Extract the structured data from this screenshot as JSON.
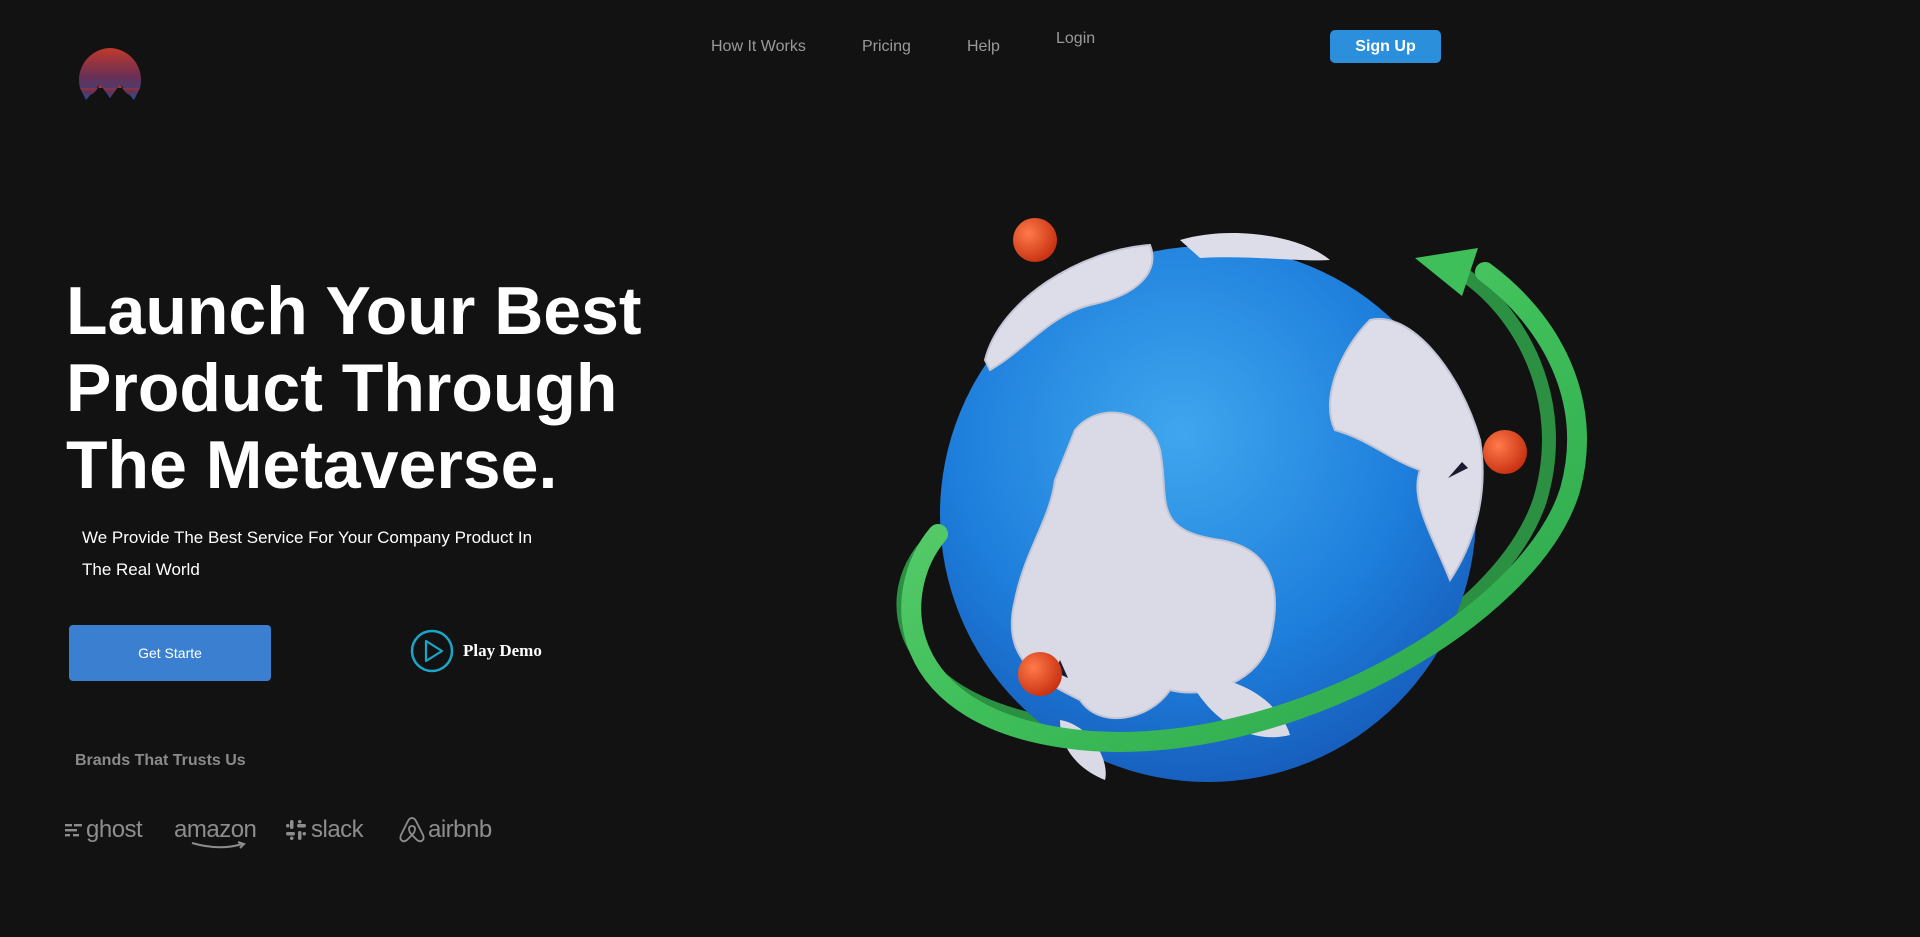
{
  "nav": {
    "links": [
      "How It Works",
      "Pricing",
      "Help",
      "Login"
    ],
    "signup_label": "Sign Up"
  },
  "hero": {
    "title_lines": [
      "Launch Your Best",
      "Product Through",
      "The Metaverse."
    ],
    "subtitle_lines": [
      "We Provide The Best Service For Your Company Product In",
      "The Real World"
    ],
    "cta_label": "Get Starte",
    "demo_label": "Play Demo"
  },
  "brands": {
    "title": "Brands That Trusts Us",
    "items": [
      "ghost",
      "amazon",
      "slack",
      "airbnb"
    ]
  },
  "icons": {
    "logo": "logo-mountain-icon",
    "play": "play-circle-icon",
    "illustration": "globe-illustration"
  },
  "colors": {
    "background": "#121212",
    "accent_blue": "#2b8fdc",
    "cta_blue": "#3a7fd0",
    "play_teal": "#1aa6c8",
    "ring_green": "#3fbf5a",
    "pin_red": "#e04a22"
  }
}
